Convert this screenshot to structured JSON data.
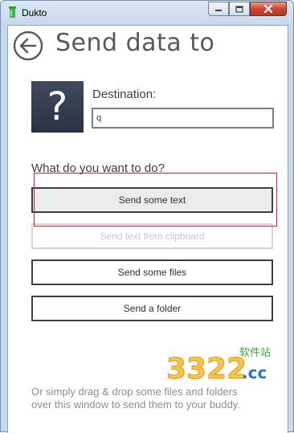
{
  "window": {
    "title": "Dukto"
  },
  "page": {
    "title": "Send data to"
  },
  "destination": {
    "label": "Destination:",
    "value": "q",
    "placeholder_symbol": "?"
  },
  "prompt": "What do you want to do?",
  "actions": [
    {
      "label": "Send some text",
      "state": "focused"
    },
    {
      "label": "Send text from clipboard",
      "state": "disabled"
    },
    {
      "label": "Send some files",
      "state": "normal"
    },
    {
      "label": "Send a folder",
      "state": "normal"
    }
  ],
  "hint": {
    "line1": "Or simply drag & drop some files and folders",
    "line2": "over this window to send them to your buddy."
  },
  "watermark": {
    "number": "3322",
    "domain": ".cc",
    "cn": "软件站"
  },
  "colors": {
    "accent_dark": "#2a3344",
    "text": "#3c3f46",
    "hint": "#8a8d93",
    "highlight": "#e02020"
  },
  "icons": {
    "back": "back-arrow-icon",
    "app": "dukto-icon"
  }
}
